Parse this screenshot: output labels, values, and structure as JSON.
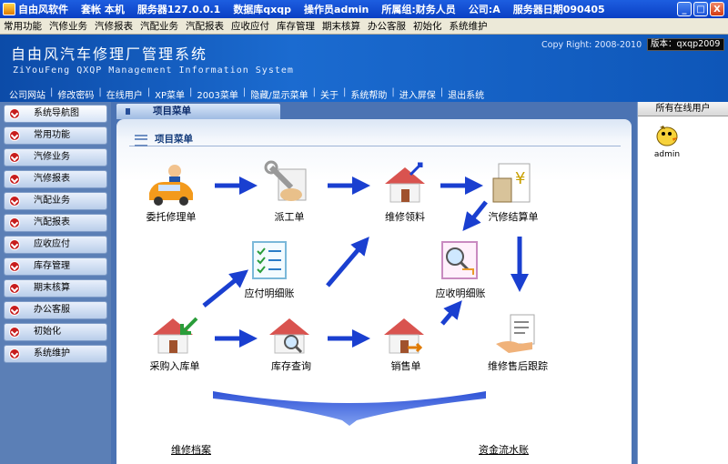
{
  "titlebar": {
    "segments": [
      "自由风软件",
      "套帐 本机",
      "服务器127.0.0.1",
      "数据库qxqp",
      "操作员admin",
      "所属组:财务人员",
      "公司:A",
      "服务器日期090405"
    ],
    "minimize": "_",
    "maximize": "□",
    "close": "X"
  },
  "menubar": [
    "常用功能",
    "汽修业务",
    "汽修报表",
    "汽配业务",
    "汽配报表",
    "应收应付",
    "库存管理",
    "期末核算",
    "办公客服",
    "初始化",
    "系统维护"
  ],
  "banner": {
    "title": "自由风汽车修理厂管理系统",
    "subtitle": "ZiYouFeng QXQP Management Information System",
    "copyright": "Copy Right: 2008-2010",
    "version": "版本：qxqp2009",
    "links": [
      "公司网站",
      "修改密码",
      "在线用户",
      "XP菜单",
      "2003菜单",
      "隐藏/显示菜单",
      "关于",
      "系统帮助",
      "进入屏保",
      "退出系统"
    ]
  },
  "leftnav": {
    "items": [
      "系统导航图",
      "常用功能",
      "汽修业务",
      "汽修报表",
      "汽配业务",
      "汽配报表",
      "应收应付",
      "库存管理",
      "期末核算",
      "办公客服",
      "初始化",
      "系统维护"
    ]
  },
  "main": {
    "tab": "项目菜单",
    "panel_title": "项目菜单",
    "nodes": {
      "commission": "委托修理单",
      "dispatch": "派工单",
      "material": "维修领料",
      "settlement": "汽修结算单",
      "payable": "应付明细账",
      "receivable": "应收明细账",
      "purchase": "采购入库单",
      "stock": "库存查询",
      "sales": "销售单",
      "aftersales": "维修售后跟踪"
    },
    "bottom_links": [
      "维修档案",
      "资金流水账"
    ]
  },
  "rightpanel": {
    "header": "所有在线用户",
    "users": [
      "admin"
    ]
  },
  "colors": {
    "titlebar": "#0a3fc4",
    "banner": "#1b6bd0",
    "arrow": "#1a3fd0",
    "nav_bg": "#5b7fb6"
  }
}
